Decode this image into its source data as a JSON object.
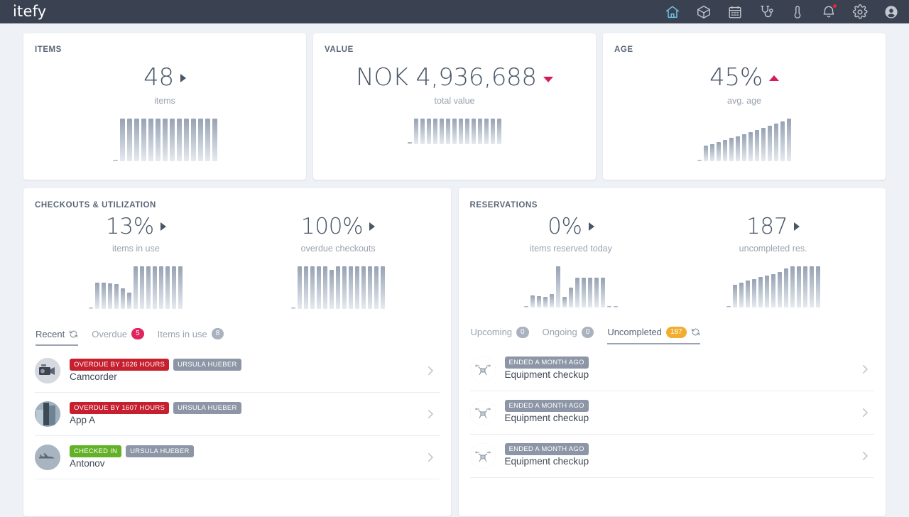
{
  "topbar": {
    "logo": "itefy",
    "icons": [
      {
        "name": "home-icon",
        "label": "Home",
        "active": true
      },
      {
        "name": "box-icon",
        "label": "Equipment",
        "active": false
      },
      {
        "name": "calendar-icon",
        "label": "Calendar",
        "active": false
      },
      {
        "name": "stethoscope-icon",
        "label": "Maintenance",
        "active": false
      },
      {
        "name": "thermometer-icon",
        "label": "Monitoring",
        "active": false
      },
      {
        "name": "bell-icon",
        "label": "Notifications",
        "active": false,
        "has_dot": true
      },
      {
        "name": "gear-icon",
        "label": "Settings",
        "active": false
      },
      {
        "name": "user-avatar-icon",
        "label": "Account",
        "active": false
      }
    ]
  },
  "kpi_cards": [
    {
      "title": "ITEMS",
      "value": "48",
      "label": "items",
      "trend": "right"
    },
    {
      "title": "VALUE",
      "value": "NOK 4,936,688",
      "label": "total value",
      "trend": "down"
    },
    {
      "title": "AGE",
      "value": "45%",
      "label": "avg. age",
      "trend": "up"
    }
  ],
  "checkouts": {
    "title": "CHECKOUTS & UTILIZATION",
    "metrics": [
      {
        "value": "13%",
        "label": "items in use",
        "trend": "right"
      },
      {
        "value": "100%",
        "label": "overdue checkouts",
        "trend": "right"
      }
    ],
    "tabs": [
      {
        "label": "Recent",
        "badge": null,
        "badge_style": "",
        "active": true,
        "refresh": true
      },
      {
        "label": "Overdue",
        "badge": "5",
        "badge_style": "pink",
        "active": false,
        "refresh": false
      },
      {
        "label": "Items in use",
        "badge": "8",
        "badge_style": "grey",
        "active": false,
        "refresh": false
      }
    ],
    "rows": [
      {
        "status": "OVERDUE BY 1626 HOURS",
        "status_style": "red",
        "user": "URSULA HUEBER",
        "name": "Camcorder",
        "thumb": "camcorder-thumbnail"
      },
      {
        "status": "OVERDUE BY 1607 HOURS",
        "status_style": "red",
        "user": "URSULA HUEBER",
        "name": "App A",
        "thumb": "app-thumbnail"
      },
      {
        "status": "CHECKED IN",
        "status_style": "green",
        "user": "URSULA HUEBER",
        "name": "Antonov",
        "thumb": "airplane-thumbnail"
      }
    ]
  },
  "reservations": {
    "title": "RESERVATIONS",
    "metrics": [
      {
        "value": "0%",
        "label": "items reserved today",
        "trend": "right"
      },
      {
        "value": "187",
        "label": "uncompleted res.",
        "trend": "right"
      }
    ],
    "tabs": [
      {
        "label": "Upcoming",
        "badge": "0",
        "badge_style": "grey",
        "active": false,
        "refresh": false
      },
      {
        "label": "Ongoing",
        "badge": "0",
        "badge_style": "grey",
        "active": false,
        "refresh": false
      },
      {
        "label": "Uncompleted",
        "badge": "187",
        "badge_style": "amber",
        "active": true,
        "refresh": true
      }
    ],
    "rows": [
      {
        "status": "ENDED A MONTH AGO",
        "status_style": "grey",
        "user": null,
        "name": "Equipment checkup",
        "thumb": "drone-thumbnail"
      },
      {
        "status": "ENDED A MONTH AGO",
        "status_style": "grey",
        "user": null,
        "name": "Equipment checkup",
        "thumb": "drone-thumbnail"
      },
      {
        "status": "ENDED A MONTH AGO",
        "status_style": "grey",
        "user": null,
        "name": "Equipment checkup",
        "thumb": "drone-thumbnail"
      }
    ]
  },
  "chart_data": [
    {
      "type": "bar",
      "title": "ITEMS sparkline",
      "categories": [
        "1",
        "2",
        "3",
        "4",
        "5",
        "6",
        "7",
        "8",
        "9",
        "10",
        "11",
        "12",
        "13",
        "14",
        "15"
      ],
      "values": [
        2,
        60,
        60,
        60,
        60,
        60,
        60,
        60,
        60,
        60,
        60,
        60,
        60,
        60,
        60
      ],
      "ylim": [
        0,
        66
      ],
      "grid": false,
      "legend": "none",
      "xlabel": "",
      "ylabel": ""
    },
    {
      "type": "bar",
      "title": "VALUE sparkline",
      "categories": [
        "1",
        "2",
        "3",
        "4",
        "5",
        "6",
        "7",
        "8",
        "9",
        "10",
        "11",
        "12",
        "13",
        "14",
        "15"
      ],
      "values": [
        3,
        36,
        36,
        36,
        36,
        36,
        36,
        36,
        36,
        36,
        36,
        36,
        36,
        36,
        36
      ],
      "ylim": [
        0,
        66
      ],
      "grid": false,
      "legend": "none",
      "xlabel": "",
      "ylabel": ""
    },
    {
      "type": "bar",
      "title": "AGE sparkline",
      "categories": [
        "1",
        "2",
        "3",
        "4",
        "5",
        "6",
        "7",
        "8",
        "9",
        "10",
        "11",
        "12",
        "13",
        "14",
        "15"
      ],
      "values": [
        2,
        22,
        24,
        27,
        30,
        33,
        35,
        38,
        41,
        44,
        47,
        50,
        53,
        56,
        60
      ],
      "ylim": [
        0,
        66
      ],
      "grid": false,
      "legend": "none",
      "xlabel": "",
      "ylabel": ""
    },
    {
      "type": "bar",
      "title": "items in use sparkline",
      "categories": [
        "1",
        "2",
        "3",
        "4",
        "5",
        "6",
        "7",
        "8",
        "9",
        "10",
        "11",
        "12",
        "13",
        "14",
        "15"
      ],
      "values": [
        2,
        34,
        34,
        33,
        32,
        26,
        21,
        55,
        55,
        55,
        55,
        55,
        55,
        55,
        55
      ],
      "ylim": [
        0,
        60
      ],
      "grid": false,
      "legend": "none",
      "xlabel": "",
      "ylabel": ""
    },
    {
      "type": "bar",
      "title": "overdue checkouts sparkline",
      "categories": [
        "1",
        "2",
        "3",
        "4",
        "5",
        "6",
        "7",
        "8",
        "9",
        "10",
        "11",
        "12",
        "13",
        "14",
        "15"
      ],
      "values": [
        2,
        60,
        60,
        60,
        60,
        60,
        55,
        60,
        60,
        60,
        60,
        60,
        60,
        60,
        60
      ],
      "ylim": [
        0,
        66
      ],
      "grid": false,
      "legend": "none",
      "xlabel": "",
      "ylabel": ""
    },
    {
      "type": "bar",
      "title": "items reserved today sparkline",
      "categories": [
        "1",
        "2",
        "3",
        "4",
        "5",
        "6",
        "7",
        "8",
        "9",
        "10",
        "11",
        "12",
        "13",
        "14",
        "15"
      ],
      "values": [
        2,
        17,
        16,
        15,
        19,
        58,
        15,
        28,
        42,
        42,
        42,
        42,
        42,
        2,
        2
      ],
      "ylim": [
        0,
        66
      ],
      "grid": false,
      "legend": "none",
      "xlabel": "",
      "ylabel": ""
    },
    {
      "type": "bar",
      "title": "uncompleted res. sparkline",
      "categories": [
        "1",
        "2",
        "3",
        "4",
        "5",
        "6",
        "7",
        "8",
        "9",
        "10",
        "11",
        "12",
        "13",
        "14",
        "15"
      ],
      "values": [
        2,
        32,
        35,
        38,
        40,
        43,
        45,
        47,
        50,
        55,
        58,
        58,
        58,
        58,
        58
      ],
      "ylim": [
        0,
        66
      ],
      "grid": false,
      "legend": "none",
      "xlabel": "",
      "ylabel": ""
    }
  ]
}
